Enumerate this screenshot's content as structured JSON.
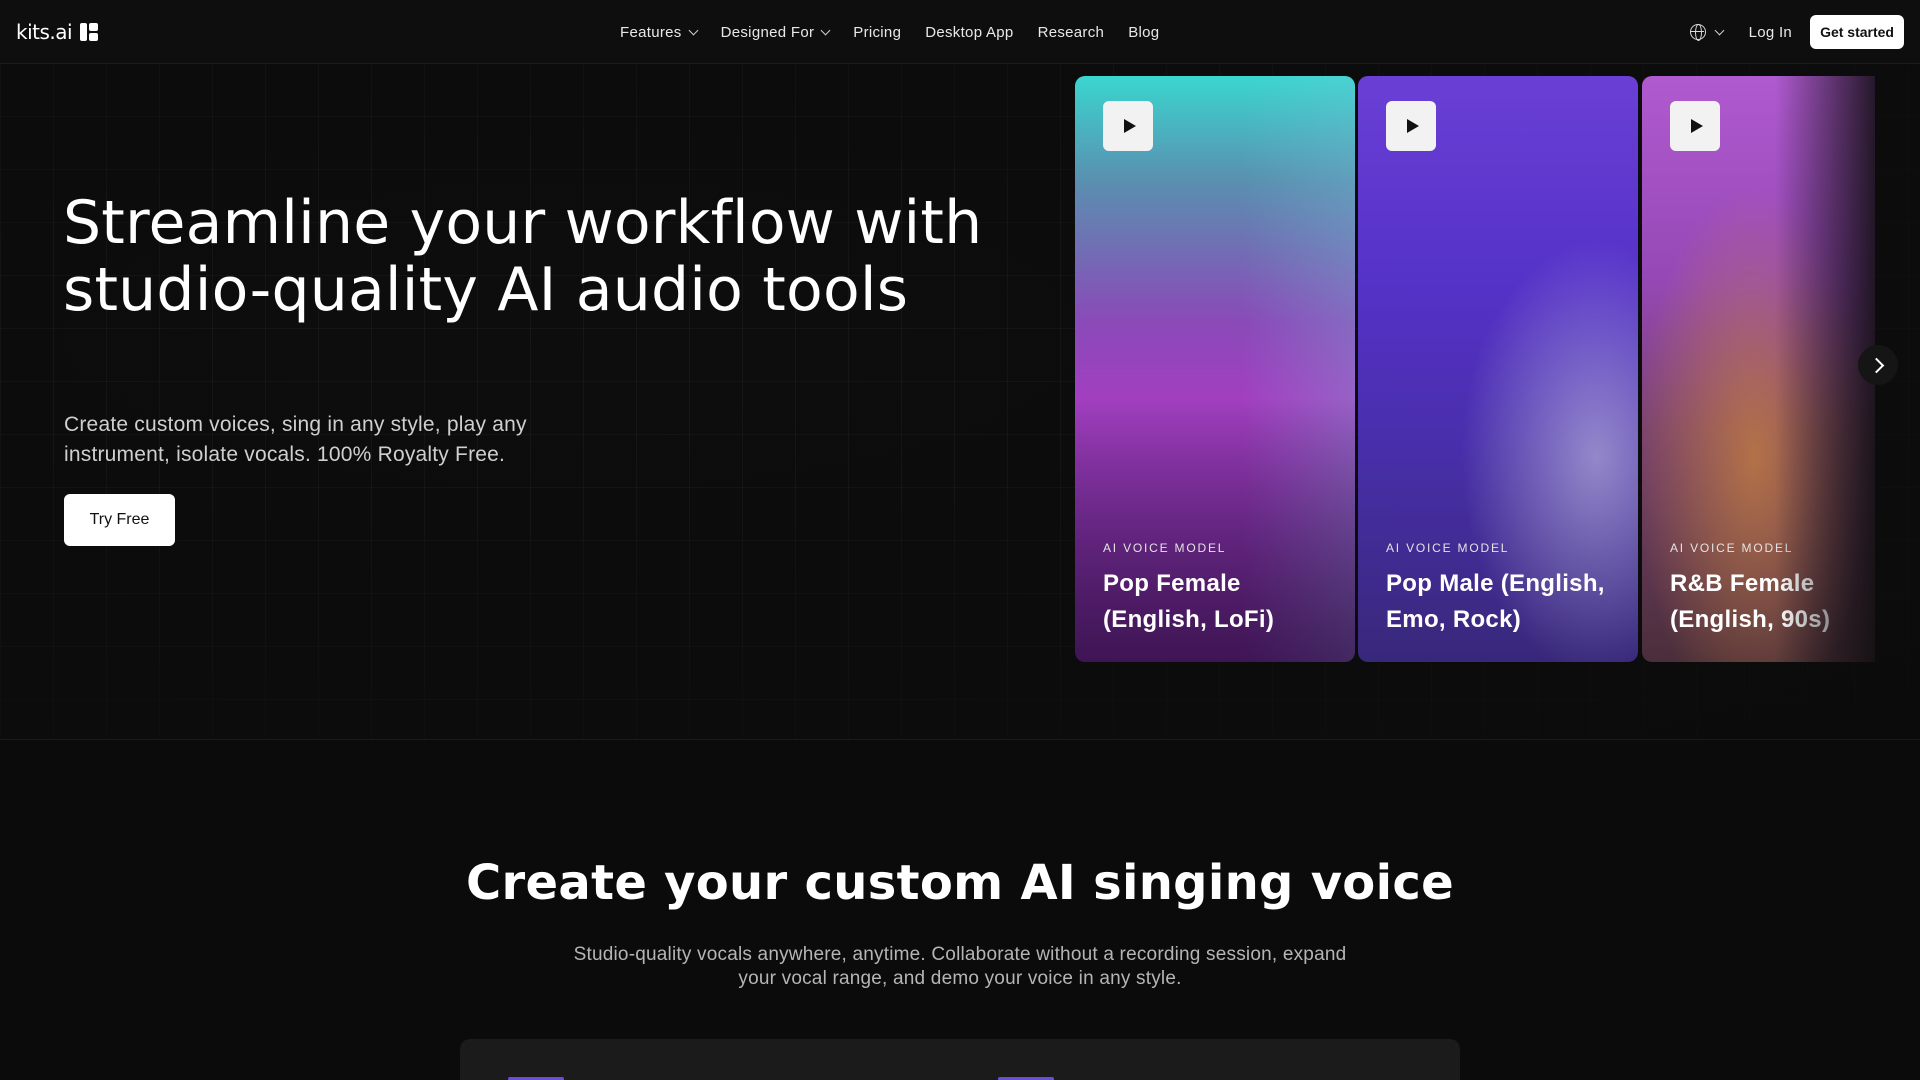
{
  "nav": {
    "logo_text": "kits.ai",
    "items": [
      {
        "label": "Features",
        "dropdown": true
      },
      {
        "label": "Designed For",
        "dropdown": true
      },
      {
        "label": "Pricing",
        "dropdown": false
      },
      {
        "label": "Desktop App",
        "dropdown": false
      },
      {
        "label": "Research",
        "dropdown": false
      },
      {
        "label": "Blog",
        "dropdown": false
      }
    ],
    "language_icon": "globe-icon",
    "login_label": "Log In",
    "cta_label": "Get started"
  },
  "hero": {
    "title": "Streamline your workflow with studio-quality AI audio tools",
    "subtitle": "Create custom voices, sing in any style, play any instrument, isolate vocals. 100% Royalty Free.",
    "cta_label": "Try Free"
  },
  "voice_cards": [
    {
      "tag": "AI VOICE MODEL",
      "name": "Pop Female (English, LoFi)",
      "icon": "play-icon"
    },
    {
      "tag": "AI VOICE MODEL",
      "name": "Pop Male (English, Emo, Rock)",
      "icon": "play-icon"
    },
    {
      "tag": "AI VOICE MODEL",
      "name": "R&B Female (English, 90s)",
      "icon": "play-icon"
    }
  ],
  "carousel": {
    "next_icon": "chevron-right-icon"
  },
  "section_voice": {
    "title": "Create your custom AI singing voice",
    "subtitle": "Studio-quality vocals anywhere, anytime. Collaborate without a recording session, expand your vocal range, and demo your voice in any style."
  },
  "colors": {
    "background": "#0b0b0b",
    "accent": "#6a4fd6",
    "button_bg": "#ffffff"
  }
}
